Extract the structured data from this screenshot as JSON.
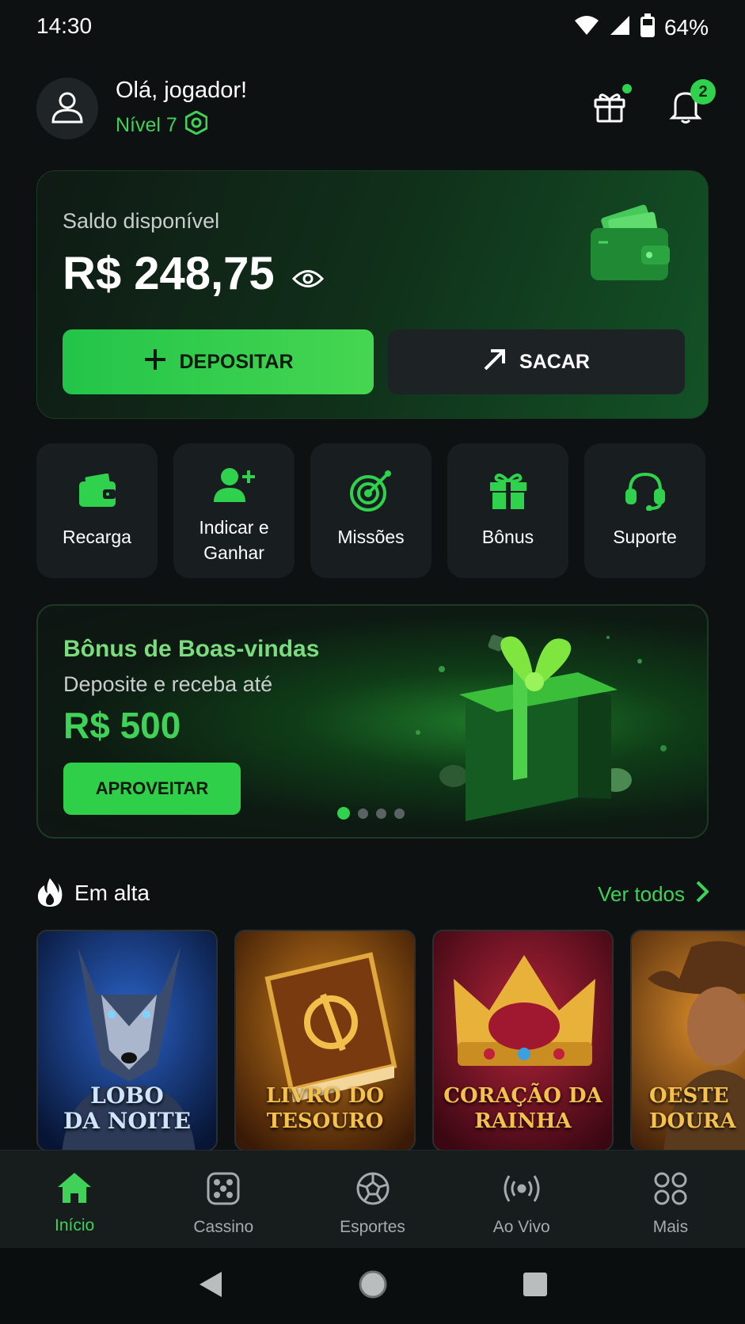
{
  "status_bar": {
    "time": "14:30",
    "battery": "64%"
  },
  "header": {
    "greeting": "Olá, jogador!",
    "level": "Nível 7",
    "notification_count": "2"
  },
  "balance": {
    "label": "Saldo disponível",
    "value": "R$ 248,75",
    "deposit_label": "DEPOSITAR",
    "withdraw_label": "SACAR"
  },
  "quick_actions": [
    {
      "label": "Recarga",
      "icon": "wallet-icon"
    },
    {
      "label": "Indicar e Ganhar",
      "icon": "add-user-icon"
    },
    {
      "label": "Missões",
      "icon": "target-icon"
    },
    {
      "label": "Bônus",
      "icon": "gift-icon"
    },
    {
      "label": "Suporte",
      "icon": "headset-icon"
    }
  ],
  "promo": {
    "title": "Bônus de Boas-vindas",
    "subtitle": "Deposite e receba até",
    "amount": "R$ 500",
    "button": "APROVEITAR",
    "slides": 4,
    "active_slide": 1
  },
  "trending": {
    "title": "Em alta",
    "see_all": "Ver todos",
    "games": [
      {
        "line1": "LOBO",
        "line2": "DA NOITE"
      },
      {
        "line1": "LIVRO DO",
        "line2": "TESOURO"
      },
      {
        "line1": "CORAÇÃO DA",
        "line2": "RAINHA"
      },
      {
        "line1": "OESTE",
        "line2": "DOURA"
      }
    ]
  },
  "bottom_nav": [
    {
      "label": "Início",
      "active": true
    },
    {
      "label": "Cassino",
      "active": false
    },
    {
      "label": "Esportes",
      "active": false
    },
    {
      "label": "Ao Vivo",
      "active": false
    },
    {
      "label": "Mais",
      "active": false
    }
  ],
  "colors": {
    "accent": "#2fd14d",
    "background": "#0d1112",
    "card": "#181e1f"
  }
}
